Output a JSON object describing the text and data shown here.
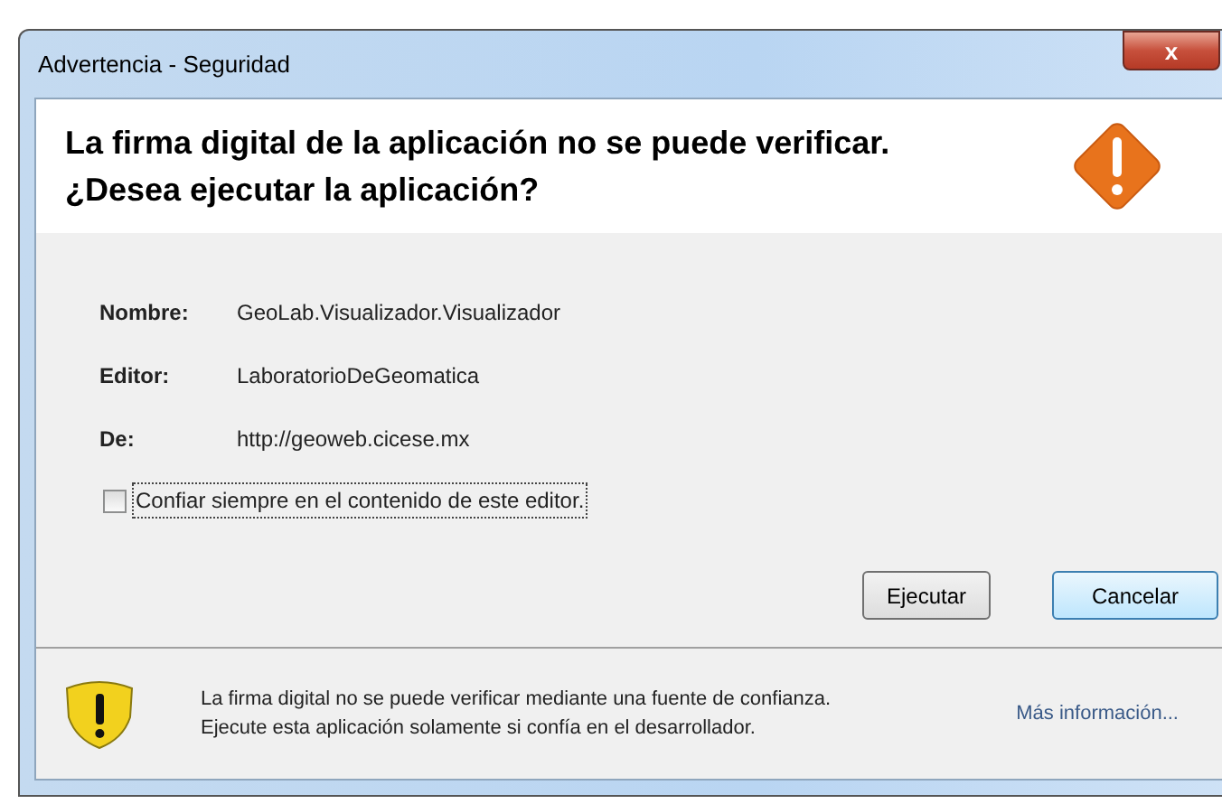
{
  "window": {
    "title": "Advertencia - Seguridad",
    "close": "x"
  },
  "header": {
    "message": "La firma digital de la aplicación no se puede verificar.\n¿Desea ejecutar la aplicación?"
  },
  "details": [
    {
      "label": "Nombre:",
      "value": "GeoLab.Visualizador.Visualizador"
    },
    {
      "label": "Editor:",
      "value": "LaboratorioDeGeomatica"
    },
    {
      "label": "De:",
      "value": "http://geoweb.cicese.mx"
    }
  ],
  "trust_checkbox": {
    "label": "Confiar siempre en el contenido de este editor.",
    "checked": false
  },
  "buttons": [
    {
      "label": "Ejecutar",
      "default": false
    },
    {
      "label": "Cancelar",
      "default": true
    }
  ],
  "footer": {
    "message": "La firma digital no se puede verificar mediante una fuente de confianza.  Ejecute esta aplicación solamente si confía en el desarrollador.",
    "link": "Más información..."
  }
}
